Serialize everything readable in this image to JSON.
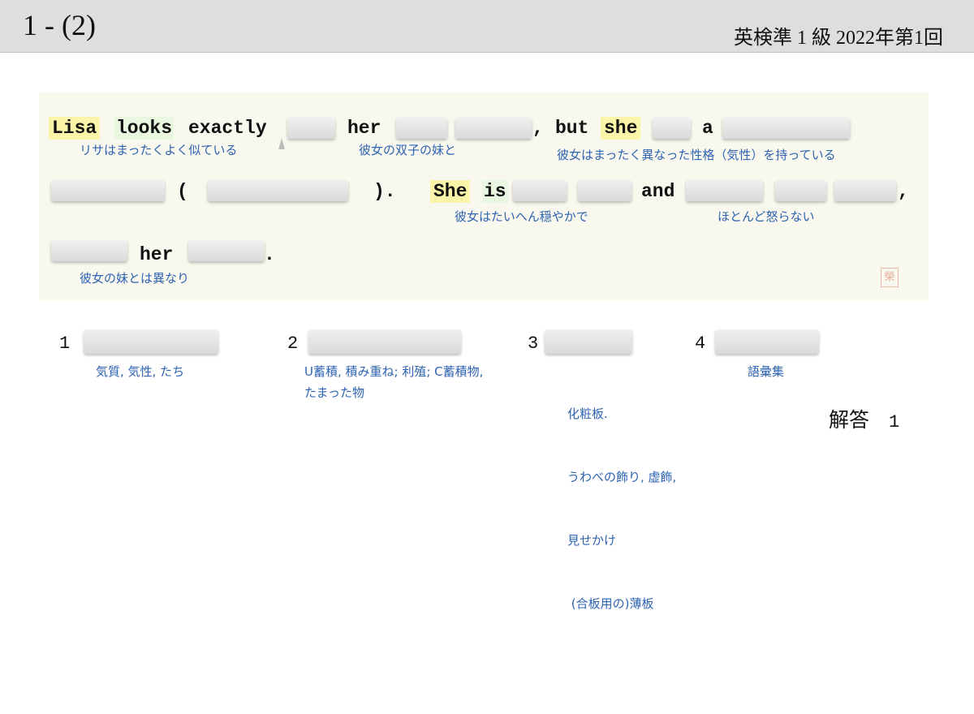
{
  "header": {
    "question_number": "1 - (2)",
    "exam_label": "英検準 1 級  2022年第1回"
  },
  "passage": {
    "words": {
      "lisa": "Lisa",
      "looks": "looks",
      "exactly": "exactly",
      "her1": "her",
      "comma1": ",",
      "but": "but",
      "she": "she",
      "a": "a",
      "paren_open": "(",
      "paren_close": ").",
      "she2": "She",
      "is": "is",
      "and": "and",
      "comma2": ",",
      "her2": "her",
      "period": "."
    },
    "glosses": {
      "g1": "リサはまったくよく似ている",
      "g2": "彼女の双子の妹と",
      "g3": "彼女はまったく異なった性格（気性）を持っている",
      "g4": "彼女はたいへん穏やかで",
      "g5": "ほとんど怒らない",
      "g6": "彼女の妹とは異なり"
    },
    "seal_char": "榮"
  },
  "options": {
    "items": [
      {
        "num": "1",
        "gloss": [
          "気質, 気性, たち"
        ]
      },
      {
        "num": "2",
        "gloss": [
          "U蓄積, 積み重ね; 利殖; C蓄積物,",
          "たまった物"
        ]
      },
      {
        "num": "3",
        "gloss": [
          "化粧板.",
          "うわべの飾り, 虚飾,",
          "見せかけ",
          " (合板用の)薄板"
        ]
      },
      {
        "num": "4",
        "gloss": [
          "語彙集"
        ]
      }
    ]
  },
  "answer": {
    "label": "解答",
    "value": "1"
  }
}
